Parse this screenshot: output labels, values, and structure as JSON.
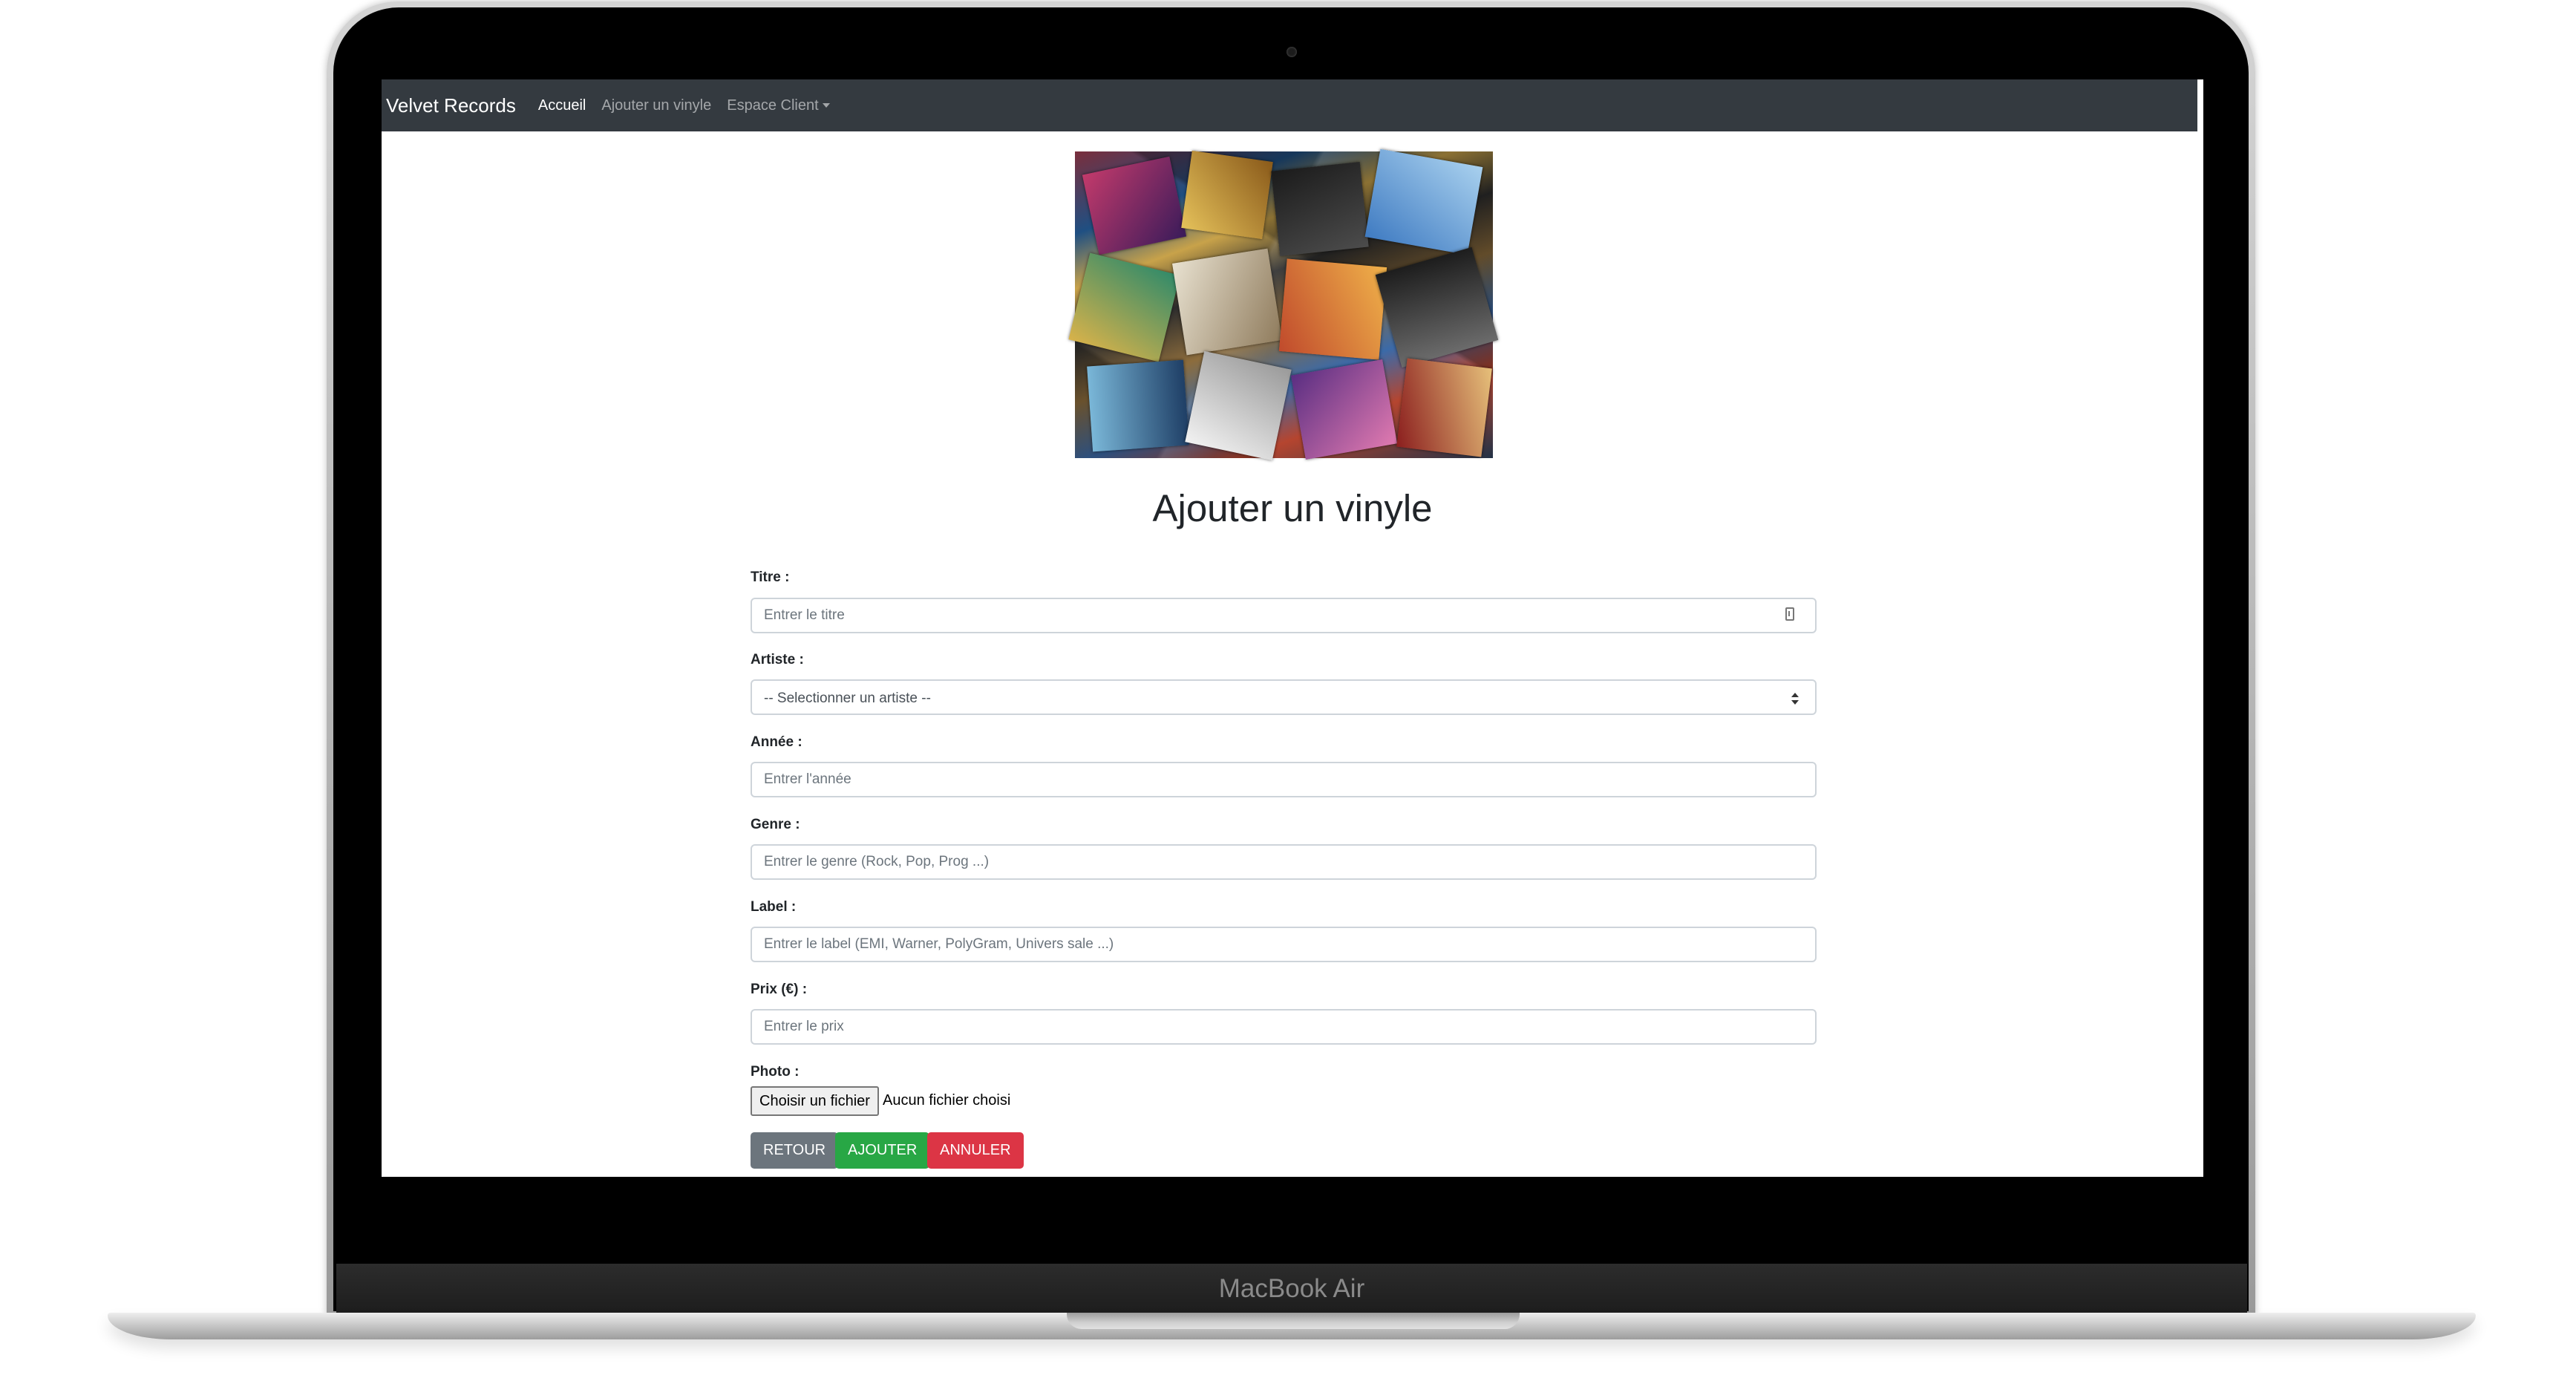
{
  "device": {
    "brand_label": "MacBook Air"
  },
  "navbar": {
    "brand": "Velvet Records",
    "links": [
      "Accueil",
      "Ajouter un vinyle",
      "Espace Client"
    ],
    "active_index": 0
  },
  "page": {
    "heading": "Ajouter un vinyle"
  },
  "form": {
    "fields": [
      {
        "label": "Titre :",
        "type": "text",
        "placeholder": "Entrer le titre",
        "value": ""
      },
      {
        "label": "Artiste :",
        "type": "select",
        "selected": "-- Selectionner un artiste --"
      },
      {
        "label": "Année :",
        "type": "text",
        "placeholder": "Entrer l'année",
        "value": ""
      },
      {
        "label": "Genre :",
        "type": "text",
        "placeholder": "Entrer le genre (Rock, Pop, Prog ...)",
        "value": ""
      },
      {
        "label": "Label :",
        "type": "text",
        "placeholder": "Entrer le label (EMI, Warner, PolyGram, Univers sale ...)",
        "value": ""
      },
      {
        "label": "Prix (€) :",
        "type": "text",
        "placeholder": "Entrer le prix",
        "value": ""
      }
    ],
    "photo": {
      "label": "Photo :",
      "button_label": "Choisir un fichier",
      "status": "Aucun fichier choisi"
    },
    "buttons": {
      "retour": "RETOUR",
      "ajouter": "AJOUTER",
      "annuler": "ANNULER"
    }
  },
  "colors": {
    "navbar_bg": "#343a40",
    "btn_secondary": "#6c757d",
    "btn_success": "#28a745",
    "btn_danger": "#dc3545"
  },
  "icons": {
    "title_field_icon": "clipboard-icon",
    "select_arrow": "select-caret-icon",
    "nav_dropdown": "caret-down-icon"
  }
}
